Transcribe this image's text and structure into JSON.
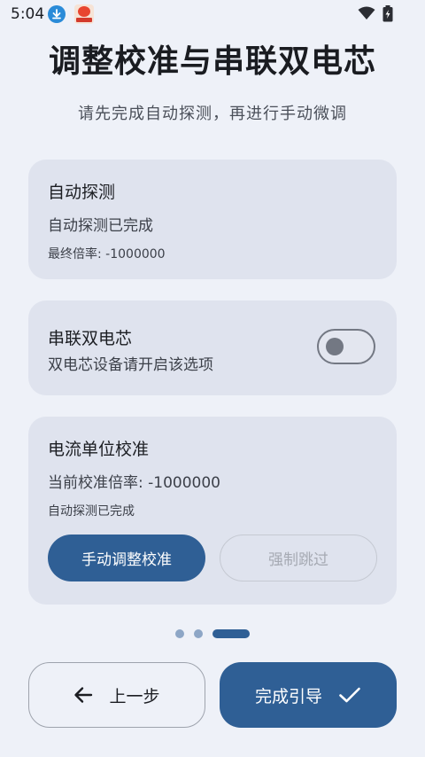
{
  "status_bar": {
    "time": "5:04",
    "icons": [
      "download-icon",
      "app-notification-icon",
      "wifi-icon",
      "battery-charging-icon"
    ]
  },
  "header": {
    "title": "调整校准与串联双电芯",
    "subtitle": "请先完成自动探测，再进行手动微调"
  },
  "auto_detect_card": {
    "title": "自动探测",
    "status": "自动探测已完成",
    "final_ratio": "最终倍率: -1000000"
  },
  "series_card": {
    "title": "串联双电芯",
    "description": "双电芯设备请开启该选项",
    "toggle_on": false
  },
  "current_card": {
    "title": "电流单位校准",
    "current_ratio": "当前校准倍率: -1000000",
    "status": "自动探测已完成",
    "manual_button": "手动调整校准",
    "skip_button": "强制跳过"
  },
  "pager": {
    "total": 3,
    "current": 3
  },
  "footer": {
    "prev_label": "上一步",
    "finish_label": "完成引导"
  },
  "colors": {
    "background": "#eef1f8",
    "card": "#dfe3ee",
    "primary": "#2f5f95",
    "dot_inactive": "#8da6c6"
  }
}
